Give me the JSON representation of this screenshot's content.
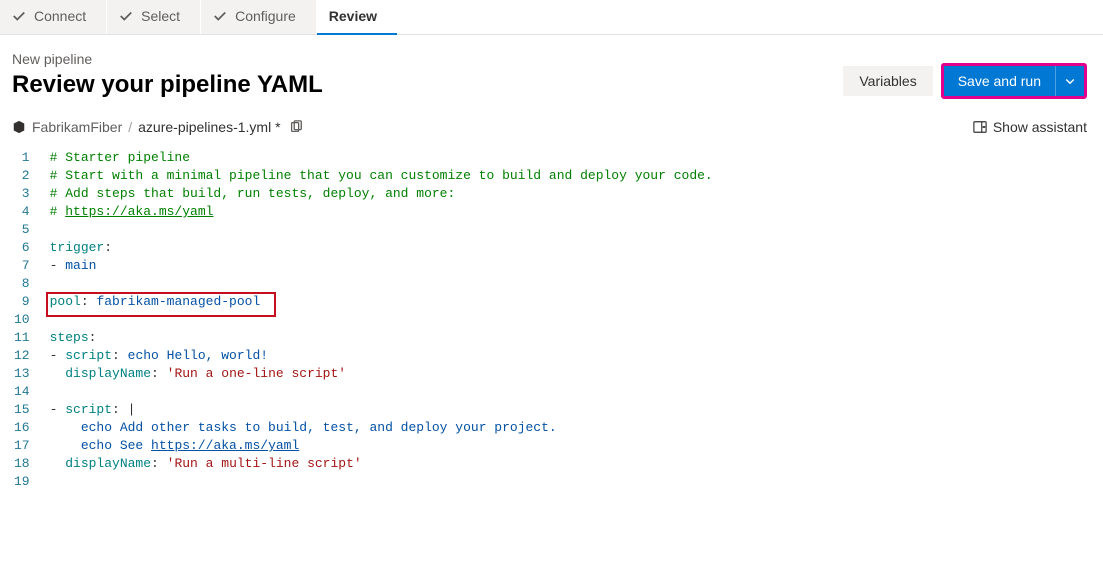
{
  "tabs": {
    "items": [
      {
        "label": "Connect",
        "done": true
      },
      {
        "label": "Select",
        "done": true
      },
      {
        "label": "Configure",
        "done": true
      },
      {
        "label": "Review",
        "active": true
      }
    ]
  },
  "header": {
    "subtitle": "New pipeline",
    "title": "Review your pipeline YAML"
  },
  "actions": {
    "variables": "Variables",
    "primary": "Save and run"
  },
  "crumb": {
    "repo": "FabrikamFiber",
    "sep": "/",
    "file": "azure-pipelines-1.yml *"
  },
  "assistant": "Show assistant",
  "code": {
    "lines": [
      {
        "n": 1,
        "segments": [
          {
            "cls": "c-comment",
            "t": "# Starter pipeline"
          }
        ]
      },
      {
        "n": 2,
        "segments": [
          {
            "cls": "c-comment",
            "t": "# Start with a minimal pipeline that you can customize to build and deploy your code."
          }
        ]
      },
      {
        "n": 3,
        "segments": [
          {
            "cls": "c-comment",
            "t": "# Add steps that build, run tests, deploy, and more:"
          }
        ]
      },
      {
        "n": 4,
        "segments": [
          {
            "cls": "c-comment",
            "t": "# "
          },
          {
            "cls": "c-comment-link",
            "t": "https://aka.ms/yaml"
          }
        ]
      },
      {
        "n": 5,
        "segments": []
      },
      {
        "n": 6,
        "segments": [
          {
            "cls": "c-key",
            "t": "trigger"
          },
          {
            "cls": "",
            "t": ":"
          }
        ]
      },
      {
        "n": 7,
        "segments": [
          {
            "cls": "",
            "t": "- "
          },
          {
            "cls": "c-value",
            "t": "main"
          }
        ]
      },
      {
        "n": 8,
        "segments": []
      },
      {
        "n": 9,
        "segments": [
          {
            "cls": "c-key",
            "t": "pool"
          },
          {
            "cls": "",
            "t": ": "
          },
          {
            "cls": "c-value",
            "t": "fabrikam-managed-pool"
          }
        ]
      },
      {
        "n": 10,
        "segments": []
      },
      {
        "n": 11,
        "segments": [
          {
            "cls": "c-key",
            "t": "steps"
          },
          {
            "cls": "",
            "t": ":"
          }
        ]
      },
      {
        "n": 12,
        "segments": [
          {
            "cls": "",
            "t": "- "
          },
          {
            "cls": "c-key",
            "t": "script"
          },
          {
            "cls": "",
            "t": ": "
          },
          {
            "cls": "c-value",
            "t": "echo Hello, world!"
          }
        ]
      },
      {
        "n": 13,
        "segments": [
          {
            "cls": "",
            "t": "  "
          },
          {
            "cls": "c-key",
            "t": "displayName"
          },
          {
            "cls": "",
            "t": ": "
          },
          {
            "cls": "c-string",
            "t": "'Run a one-line script'"
          }
        ]
      },
      {
        "n": 14,
        "segments": []
      },
      {
        "n": 15,
        "segments": [
          {
            "cls": "",
            "t": "- "
          },
          {
            "cls": "c-key",
            "t": "script"
          },
          {
            "cls": "",
            "t": ": |"
          }
        ]
      },
      {
        "n": 16,
        "segments": [
          {
            "cls": "",
            "t": "    "
          },
          {
            "cls": "c-value",
            "t": "echo Add other tasks to build, test, and deploy your project."
          }
        ]
      },
      {
        "n": 17,
        "segments": [
          {
            "cls": "",
            "t": "    "
          },
          {
            "cls": "c-value",
            "t": "echo See "
          },
          {
            "cls": "c-link",
            "t": "https://aka.ms/yaml"
          }
        ]
      },
      {
        "n": 18,
        "segments": [
          {
            "cls": "",
            "t": "  "
          },
          {
            "cls": "c-key",
            "t": "displayName"
          },
          {
            "cls": "",
            "t": ": "
          },
          {
            "cls": "c-string",
            "t": "'Run a multi-line script'"
          }
        ]
      },
      {
        "n": 19,
        "segments": []
      }
    ]
  }
}
